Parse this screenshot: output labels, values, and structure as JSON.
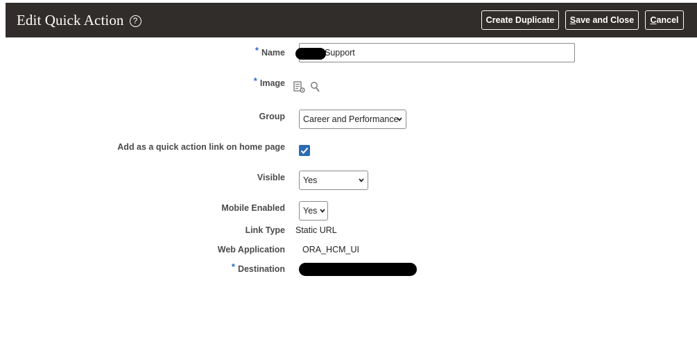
{
  "header": {
    "title": "Edit Quick Action",
    "help_glyph": "?",
    "buttons": {
      "create_duplicate": "Create Duplicate",
      "save_and_close_mnemonic": "S",
      "save_and_close_rest": "ave and Close",
      "cancel_mnemonic": "C",
      "cancel_rest": "ancel"
    },
    "background_color": "#312d2a"
  },
  "form": {
    "required_marker": "*",
    "name": {
      "label": "Name",
      "value": "Support",
      "redacted_prefix": true
    },
    "image": {
      "label": "Image",
      "icons": [
        "image-settings-icon",
        "search-icon"
      ]
    },
    "group": {
      "label": "Group",
      "selected": "Career and Performance"
    },
    "quick_action_link": {
      "label": "Add as a quick action link on home page",
      "checked": true
    },
    "visible": {
      "label": "Visible",
      "selected": "Yes"
    },
    "mobile_enabled": {
      "label": "Mobile Enabled",
      "selected": "Yes"
    },
    "link_type": {
      "label": "Link Type",
      "value": "Static URL"
    },
    "web_application": {
      "label": "Web Application",
      "value": "ORA_HCM_UI"
    },
    "destination": {
      "label": "Destination",
      "redacted": true
    }
  },
  "colors": {
    "required_asterisk": "#2a6ac8",
    "checkbox_fill": "#2b6bb3"
  }
}
